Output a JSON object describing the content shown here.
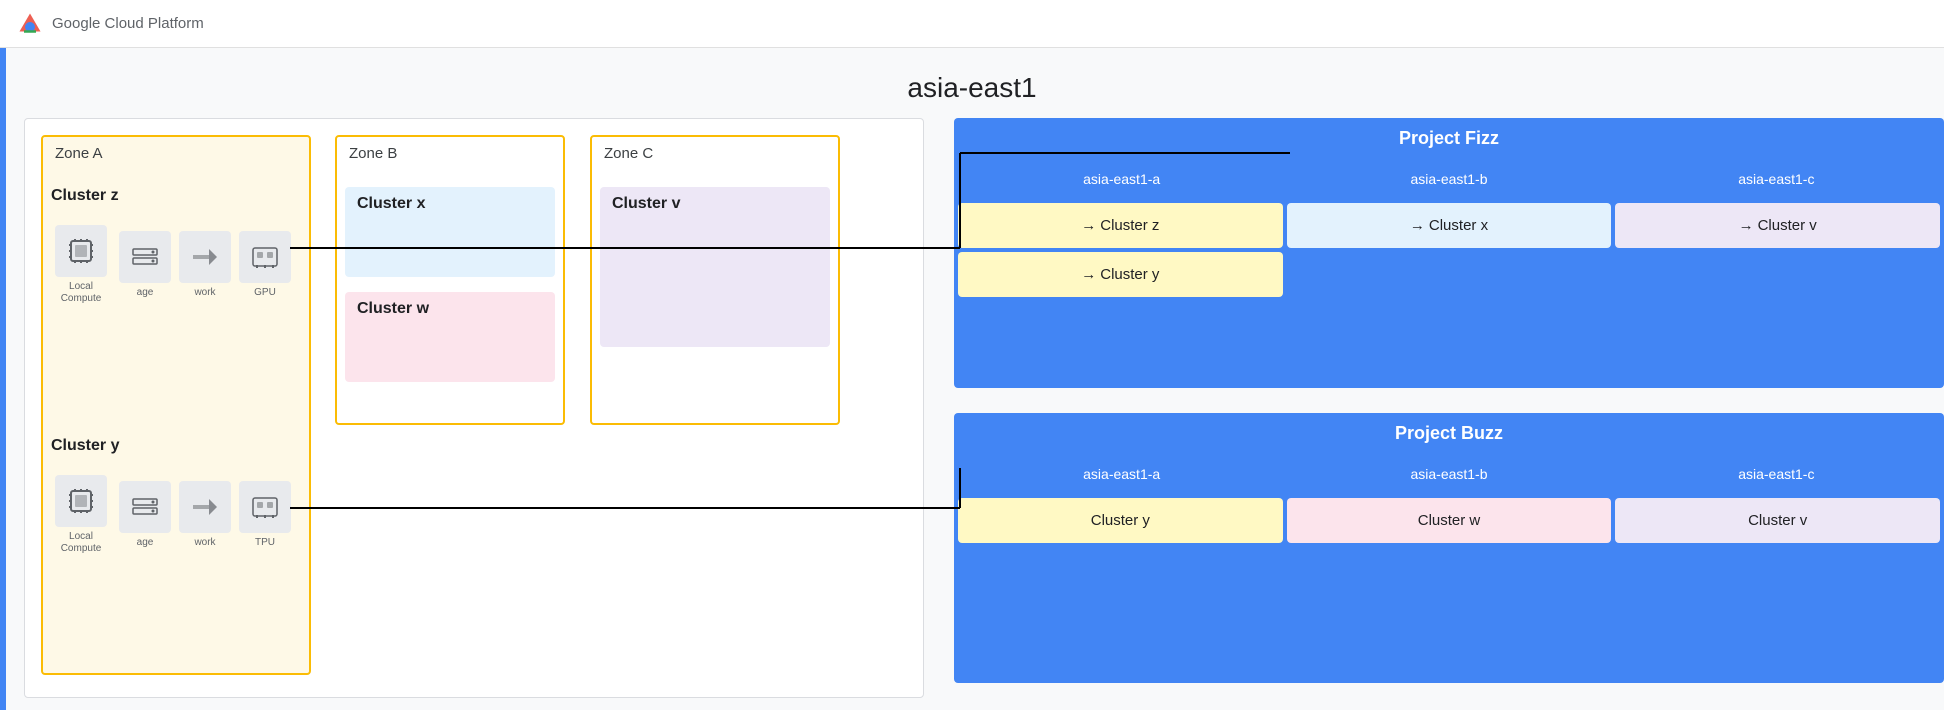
{
  "header": {
    "logo_text": "Google Cloud Platform",
    "page_title": "asia-east1"
  },
  "zones": {
    "zone_a": {
      "label": "Zone A",
      "clusters": [
        {
          "name": "Cluster z",
          "icons": [
            {
              "id": "local-compute",
              "label": "Local Compute"
            },
            {
              "id": "storage",
              "label": "age"
            },
            {
              "id": "network",
              "label": "work"
            },
            {
              "id": "gpu",
              "label": "GPU"
            }
          ]
        },
        {
          "name": "Cluster y",
          "icons": [
            {
              "id": "local-compute2",
              "label": "Local Compute"
            },
            {
              "id": "storage2",
              "label": "age"
            },
            {
              "id": "network2",
              "label": "work"
            },
            {
              "id": "tpu",
              "label": "TPU"
            }
          ]
        }
      ]
    },
    "zone_b": {
      "label": "Zone B",
      "clusters": [
        {
          "name": "Cluster x",
          "color": "blue"
        },
        {
          "name": "Cluster w",
          "color": "pink"
        }
      ]
    },
    "zone_c": {
      "label": "Zone C",
      "clusters": [
        {
          "name": "Cluster v",
          "color": "purple"
        }
      ]
    }
  },
  "projects": {
    "fizz": {
      "title": "Project Fizz",
      "columns": [
        "asia-east1-a",
        "asia-east1-b",
        "asia-east1-c"
      ],
      "clusters": [
        {
          "name": "Cluster z",
          "col": 0,
          "color": "yellow",
          "has_arrow": true
        },
        {
          "name": "Cluster x",
          "col": 1,
          "color": "blue",
          "has_arrow": true
        },
        {
          "name": "Cluster v",
          "col": 2,
          "color": "purple",
          "has_arrow": false
        },
        {
          "name": "Cluster y",
          "col": 0,
          "color": "yellow",
          "has_arrow": true
        }
      ]
    },
    "buzz": {
      "title": "Project Buzz",
      "columns": [
        "asia-east1-a",
        "asia-east1-b",
        "asia-east1-c"
      ],
      "clusters": [
        {
          "name": "Cluster y",
          "col": 0,
          "color": "yellow"
        },
        {
          "name": "Cluster w",
          "col": 1,
          "color": "pink"
        },
        {
          "name": "Cluster v",
          "col": 2,
          "color": "purple"
        }
      ]
    }
  },
  "icons": {
    "cpu": "⬜",
    "storage": "▦",
    "network": "▷",
    "gpu": "⊞",
    "tpu": "⊞"
  }
}
